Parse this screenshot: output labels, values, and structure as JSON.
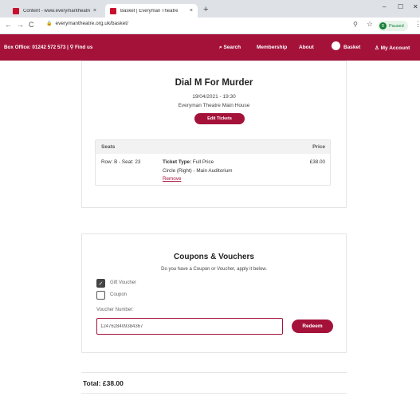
{
  "browser": {
    "tabs": [
      {
        "label": "Content - www.everymantheatre...",
        "close": "×"
      },
      {
        "label": "Basket | Everyman Theatre",
        "close": "×"
      }
    ],
    "new_tab": "+",
    "window_controls": {
      "minimize": "–",
      "maximize": "☐",
      "close": "✕"
    },
    "url": "everymantheatre.org.uk/basket/",
    "profile_initial": "D",
    "profile_status": "Paused",
    "back": "←",
    "forward": "→",
    "reload": "C",
    "menu": "⋮"
  },
  "site_nav": {
    "box_office": "Box Office: 01242 572 573 | ",
    "find_us": "⚲ Find us",
    "search": "⌕ Search",
    "membership": "Membership",
    "about": "About",
    "basket": "Basket",
    "account": "♙ My Account"
  },
  "booking": {
    "title": "Dial M For Murder",
    "datetime": "19/04/2021 - 19:30",
    "venue": "Everyman Theatre Main House",
    "edit_button": "Edit Tickets",
    "table": {
      "col_seats": "Seats",
      "col_price": "Price",
      "row_seat": "Row: B - Seat: 23",
      "ticket_type_label": "Ticket Type:",
      "ticket_type_value": " Full Price",
      "location": "Circle (Right) - Main Auditorium",
      "remove": "Remove",
      "price": "£38.00"
    }
  },
  "coupons": {
    "title": "Coupons & Vouchers",
    "subtitle": "Do you have a Coupon or Voucher, apply it below.",
    "options": [
      {
        "label": "Gift Voucher",
        "checked": true
      },
      {
        "label": "Coupon",
        "checked": false
      }
    ],
    "voucher_label": "Voucher Number:",
    "voucher_value": "1247628409384367",
    "redeem_button": "Redeem"
  },
  "total": "Total: £38.00",
  "colors": {
    "brand": "#a4123a",
    "chrome": "#dee1e6"
  }
}
